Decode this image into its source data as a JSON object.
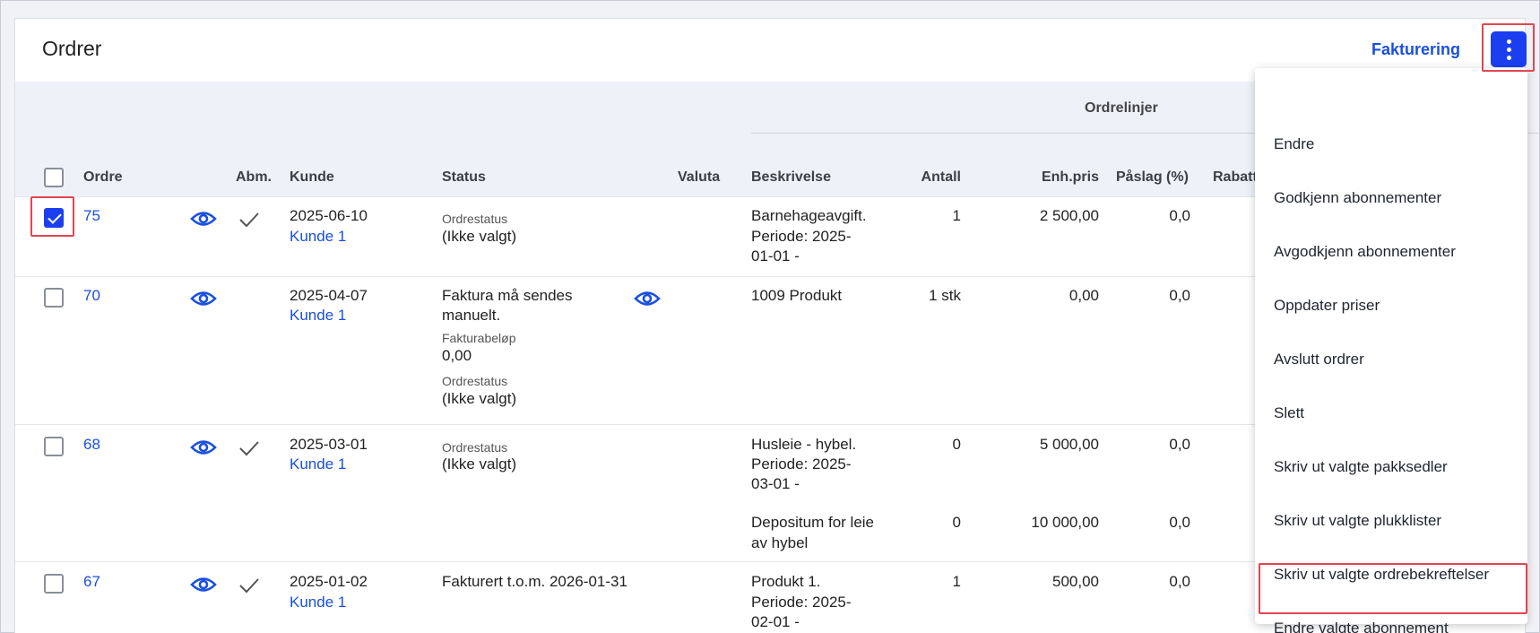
{
  "header": {
    "title": "Ordrer",
    "invoice_link": "Fakturering",
    "more_icon": "more-vertical-icon"
  },
  "table": {
    "group_header": "Ordrelinjer",
    "columns": {
      "order": "Ordre",
      "subscription": "Abm.",
      "customer": "Kunde",
      "status": "Status",
      "currency": "Valuta",
      "description": "Beskrivelse",
      "quantity": "Antall",
      "unit_price": "Enh.pris",
      "markup": "Påslag (%)",
      "discount": "Rabatt"
    },
    "rows": [
      {
        "number": "75",
        "selected": true,
        "subscription": true,
        "date": "2025-06-10",
        "customer": "Kunde 1",
        "status_label": "Ordrestatus",
        "status_value": "(Ikke valgt)",
        "lines": [
          {
            "desc": [
              "Barnehageavgift.",
              "Periode: 2025-",
              "01-01 -"
            ],
            "qty": "1",
            "price": "2 500,00",
            "markup": "0,0"
          }
        ]
      },
      {
        "number": "70",
        "selected": false,
        "subscription": false,
        "date": "2025-04-07",
        "customer": "Kunde 1",
        "status_text": [
          "Faktura må sendes",
          "manuelt."
        ],
        "invoice_amount_label": "Fakturabeløp",
        "invoice_amount": "0,00",
        "status_label": "Ordrestatus",
        "status_value": "(Ikke valgt)",
        "lines": [
          {
            "desc": [
              "1009 Produkt"
            ],
            "qty": "1 stk",
            "price": "0,00",
            "markup": "0,0"
          }
        ]
      },
      {
        "number": "68",
        "selected": false,
        "subscription": true,
        "date": "2025-03-01",
        "customer": "Kunde 1",
        "status_label": "Ordrestatus",
        "status_value": "(Ikke valgt)",
        "lines": [
          {
            "desc": [
              "Husleie - hybel.",
              "Periode: 2025-",
              "03-01 -"
            ],
            "qty": "0",
            "price": "5 000,00",
            "markup": "0,0"
          },
          {
            "desc": [
              "Depositum for leie",
              "av hybel"
            ],
            "qty": "0",
            "price": "10 000,00",
            "markup": "0,0"
          }
        ]
      },
      {
        "number": "67",
        "selected": false,
        "subscription": true,
        "date": "2025-01-02",
        "customer": "Kunde 1",
        "status_text": [
          "Fakturert t.o.m. 2026-01-31"
        ],
        "lines": [
          {
            "desc": [
              "Produkt 1.",
              "Periode: 2025-",
              "02-01 -"
            ],
            "qty": "1",
            "price": "500,00",
            "markup": "0,0"
          }
        ]
      }
    ]
  },
  "menu": {
    "items": [
      "Endre",
      "Godkjenn abonnementer",
      "Avgodkjenn abonnementer",
      "Oppdater priser",
      "Avslutt ordrer",
      "Slett",
      "Skriv ut valgte pakksedler",
      "Skriv ut valgte plukklister",
      "Skriv ut valgte ordrebekreftelser",
      "Endre valgte abonnement"
    ],
    "highlighted_index": 9
  },
  "colors": {
    "accent": "#1b3ff0",
    "link": "#1a4fe0",
    "highlight": "#e04651",
    "table_header_bg": "#eef1f8"
  }
}
